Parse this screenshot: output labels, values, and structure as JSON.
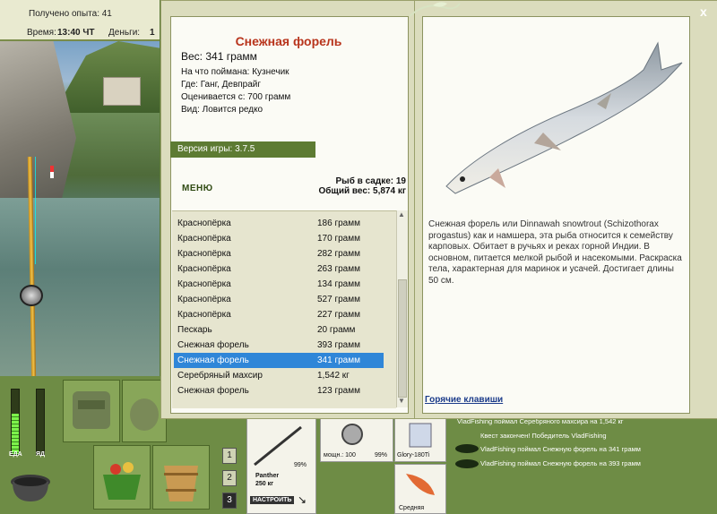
{
  "status": {
    "experience_text": "Получено опыта: 41",
    "time_label": "Время:",
    "time_value": "13:40 ЧТ",
    "money_label": "Деньги:",
    "money_value": "1"
  },
  "fish_card": {
    "title": "Снежная форель",
    "weight": "Вес: 341 грамм",
    "caught_on": "На что поймана: Кузнечик",
    "where": "Где: Ганг, Девпрайг",
    "valued_at": "Оценивается с: 700 грамм",
    "kind": "Вид: Ловится редко",
    "version": "Версия игры: 3.7.5",
    "menu_label": "МЕНЮ",
    "keep_count": "Рыб в садке: 19",
    "keep_total": "Общий вес: 5,874 кг"
  },
  "catch_list": [
    {
      "name": "Краснопёрка",
      "weight": "186 грамм"
    },
    {
      "name": "Краснопёрка",
      "weight": "170 грамм"
    },
    {
      "name": "Краснопёрка",
      "weight": "282 грамм"
    },
    {
      "name": "Краснопёрка",
      "weight": "263 грамм"
    },
    {
      "name": "Краснопёрка",
      "weight": "134 грамм"
    },
    {
      "name": "Краснопёрка",
      "weight": "527 грамм"
    },
    {
      "name": "Краснопёрка",
      "weight": "227 грамм"
    },
    {
      "name": "Пескарь",
      "weight": "20 грамм"
    },
    {
      "name": "Снежная форель",
      "weight": "393 грамм"
    },
    {
      "name": "Снежная форель",
      "weight": "341 грамм",
      "selected": true
    },
    {
      "name": "Серебряный махсир",
      "weight": "1,542 кг"
    },
    {
      "name": "Снежная форель",
      "weight": "123 грамм"
    }
  ],
  "description": "Снежная форель или Dinnawah snowtrout (Schizothorax progastus) как и намшера, эта рыба относится к семейству карповых. Обитает в ручьях и реках горной Индии. В основном, питается мелкой рыбой и насекомыми. Раскраска тела, характерная для маринок и усачей. Достигает длины 50 см.",
  "hotkeys_label": "Горячие клавиши",
  "close_label": "x",
  "meters": {
    "food_label": "ЕДА",
    "poison_label": "ЯД",
    "food_level": 0.62,
    "poison_level": 0.0
  },
  "tabs": [
    "1",
    "2",
    "3"
  ],
  "tackle": {
    "rod_name": "Panther",
    "rod_weight": "250 кг",
    "rod_condition": "99%",
    "reel_label": "мощн.: 100",
    "reel_condition": "99%",
    "line_name": "Glory-180Ti",
    "lure_label": "Средняя",
    "setup_button": "НАСТРОИТЬ"
  },
  "log": [
    "VladFishing поймал Серебряного махсира на 1,542 кг",
    "Квест закончен! Победитель VladFishing",
    "VladFishing поймал Снежную форель на 341 грамм",
    "VladFishing поймал Снежную форель на 393 грамм"
  ],
  "colors": {
    "title_red": "#b8341c",
    "selection_blue": "#2f86d8",
    "panel_green": "#6e8c45"
  }
}
